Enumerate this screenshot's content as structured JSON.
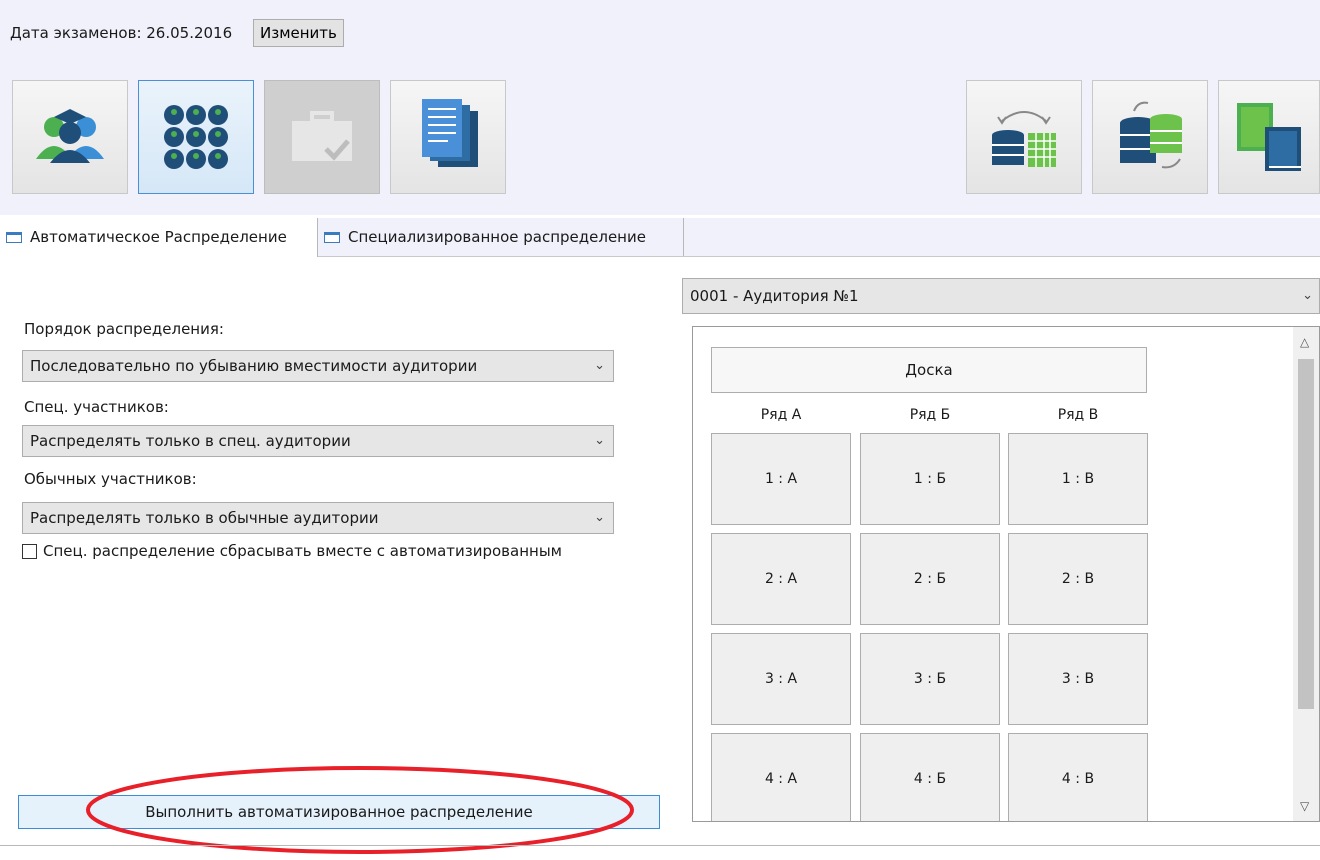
{
  "header": {
    "date_label": "Дата экзаменов: 26.05.2016",
    "change_button": "Изменить"
  },
  "toolbar": {
    "left_tools": [
      {
        "name": "participants",
        "icon": "users-icon"
      },
      {
        "name": "seating",
        "icon": "seats-grid-icon",
        "active": true
      },
      {
        "name": "briefcase",
        "icon": "briefcase-check-icon",
        "disabled": true
      },
      {
        "name": "documents",
        "icon": "documents-icon"
      }
    ],
    "right_tools": [
      {
        "name": "db-exchange",
        "icon": "database-building-icon"
      },
      {
        "name": "db-sync",
        "icon": "database-sync-icon"
      },
      {
        "name": "books",
        "icon": "books-icon"
      }
    ]
  },
  "tabs": [
    {
      "label": "Автоматическое Распределение",
      "active": true
    },
    {
      "label": "Специализированное распределение",
      "active": false
    }
  ],
  "form": {
    "order_label": "Порядок распределения:",
    "order_value": "Последовательно по убыванию вместимости аудитории",
    "special_label": "Спец. участников:",
    "special_value": "Распределять только в спец. аудитории",
    "regular_label": "Обычных участников:",
    "regular_value": "Распределять только в обычные аудитории",
    "reset_checkbox_label": "Спец. распределение сбрасывать вместе с автоматизированным",
    "reset_checkbox_checked": false,
    "run_button": "Выполнить автоматизированное распределение"
  },
  "room": {
    "selected": "0001 - Аудитория №1",
    "board_label": "Доска",
    "rows": [
      "Ряд А",
      "Ряд Б",
      "Ряд В"
    ],
    "seats": [
      [
        "1 : А",
        "1 : Б",
        "1 : В"
      ],
      [
        "2 : А",
        "2 : Б",
        "2 : В"
      ],
      [
        "3 : А",
        "3 : Б",
        "3 : В"
      ],
      [
        "4 : А",
        "4 : Б",
        "4 : В"
      ]
    ]
  },
  "colors": {
    "accent_blue": "#3c8cd8",
    "annotation_red": "#e8202a"
  }
}
